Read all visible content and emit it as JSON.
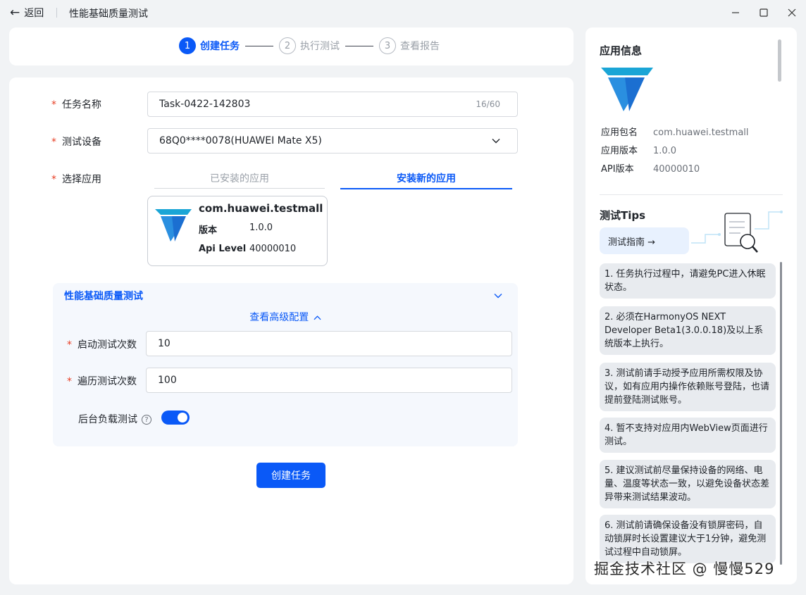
{
  "header": {
    "back_label": "返回",
    "title": "性能基础质量测试"
  },
  "steps": [
    {
      "num": "1",
      "label": "创建任务"
    },
    {
      "num": "2",
      "label": "执行测试"
    },
    {
      "num": "3",
      "label": "查看报告"
    }
  ],
  "form": {
    "task_name": {
      "label": "任务名称",
      "value": "Task-0422-142803",
      "count": "16/60"
    },
    "device": {
      "label": "测试设备",
      "value": "68Q0****0078(HUAWEI Mate X5)"
    },
    "app": {
      "label": "选择应用",
      "tab_installed": "已安装的应用",
      "tab_new": "安装新的应用",
      "card": {
        "package": "com.huawei.testmall",
        "version_label": "版本",
        "version_value": "1.0.0",
        "api_label": "Api Level",
        "api_value": "40000010"
      }
    },
    "section": {
      "title": "性能基础质量测试",
      "advanced_label": "查看高级配置",
      "launch_count": {
        "label": "启动测试次数",
        "value": "10"
      },
      "traverse_count": {
        "label": "遍历测试次数",
        "value": "100"
      },
      "background_load": {
        "label": "后台负载测试",
        "enabled": true
      }
    },
    "submit_label": "创建任务"
  },
  "side": {
    "app_info_title": "应用信息",
    "info": [
      {
        "key": "应用包名",
        "value": "com.huawei.testmall"
      },
      {
        "key": "应用版本",
        "value": "1.0.0"
      },
      {
        "key": "API版本",
        "value": "40000010"
      }
    ],
    "tips_title": "测试Tips",
    "guide_label": "测试指南 →",
    "tips": [
      "1. 任务执行过程中，请避免PC进入休眠状态。",
      "2. 必须在HarmonyOS NEXT Developer Beta1(3.0.0.18)及以上系统版本上执行。",
      "3. 测试前请手动授予应用所需权限及协议，如有应用内操作依赖账号登陆，也请提前登陆测试账号。",
      "4. 暂不支持对应用内WebView页面进行测试。",
      "5. 建议测试前尽量保持设备的网络、电量、温度等状态一致，以避免设备状态差异带来测试结果波动。",
      "6. 测试前请确保设备没有锁屏密码，自动锁屏时长设置建议大于1分钟，避免测试过程中自动锁屏。"
    ]
  },
  "watermark": "掘金技术社区 @ 慢慢529",
  "colors": {
    "accent": "#0a59f7",
    "required": "#e84026"
  },
  "icons": [
    "back-arrow-icon",
    "minimize-icon",
    "maximize-icon",
    "close-icon",
    "chevron-down-icon",
    "chevron-up-icon",
    "help-icon",
    "app-logo-icon",
    "doc-search-illustration"
  ]
}
